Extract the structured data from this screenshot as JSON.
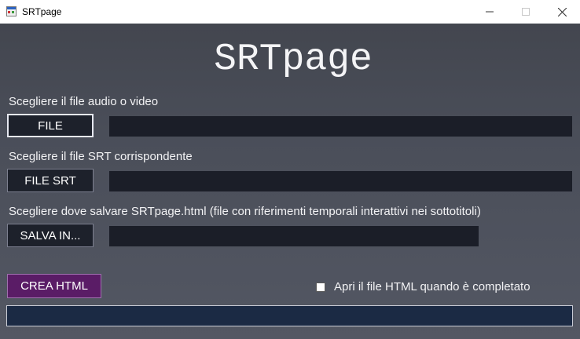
{
  "window": {
    "title": "SRTpage"
  },
  "app": {
    "title": "SRTpage"
  },
  "media": {
    "label": "Scegliere il file audio o video",
    "button_label": "FILE",
    "path": ""
  },
  "srt": {
    "label": "Scegliere il file SRT corrispondente",
    "button_label": "FILE SRT",
    "path": ""
  },
  "output": {
    "label": "Scegliere dove salvare SRTpage.html (file con riferimenti temporali interattivi nei sottotitoli)",
    "button_label": "SALVA IN...",
    "path": ""
  },
  "actions": {
    "create_label": "CREA HTML"
  },
  "options": {
    "open_when_done_label": "Apri il file HTML quando è completato",
    "open_when_done_checked": false
  },
  "progress": {
    "value": 0
  },
  "colors": {
    "background": "#4a4e59",
    "button": "#1d212b",
    "field": "#1b1e28",
    "create_button": "#5a1c66",
    "progress_bar": "#1b2a44"
  },
  "icons": {
    "app": "app-window-icon",
    "minimize": "minimize-icon",
    "maximize": "maximize-icon",
    "close": "close-icon"
  }
}
